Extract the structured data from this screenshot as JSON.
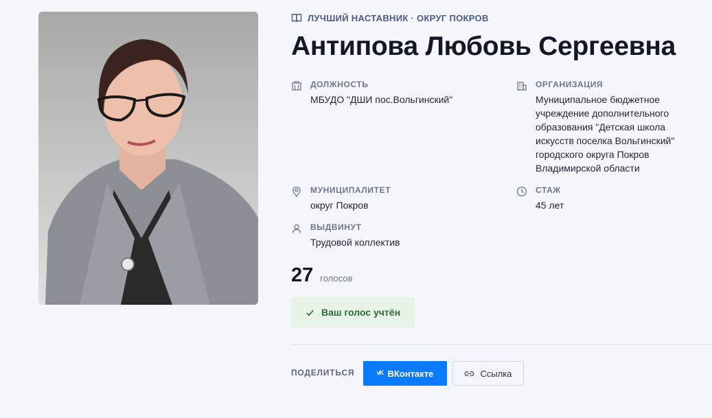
{
  "category": {
    "icon": "book-icon",
    "text": "ЛУЧШИЙ НАСТАВНИК · ОКРУГ ПОКРОВ"
  },
  "person": {
    "name": "Антипова Любовь Сергеевна",
    "photo_alt": "portrait"
  },
  "fields": {
    "position": {
      "icon": "building-icon",
      "label": "ДОЛЖНОСТЬ",
      "value": "МБУДО \"ДШИ пос.Вольгинский\""
    },
    "organization": {
      "icon": "office-icon",
      "label": "ОРГАНИЗАЦИЯ",
      "value": "Муниципальное бюджетное\nучреждение дополнительного\nобразования \"Детская школа\nискусств поселка Вольгинский\"\nгородского округа Покров\nВладимирской области"
    },
    "municipality": {
      "icon": "location-pin-icon",
      "label": "МУНИЦИПАЛИТЕТ",
      "value": "округ Покров"
    },
    "experience": {
      "icon": "clock-icon",
      "label": "СТАЖ",
      "value": "45 лет"
    },
    "nominated": {
      "icon": "user-icon",
      "label": "ВЫДВИНУТ",
      "value": "Трудовой коллектив"
    }
  },
  "votes": {
    "count": "27",
    "label": "голосов"
  },
  "vote_status": {
    "icon": "check-icon",
    "text": "Ваш голос учтён"
  },
  "share": {
    "label": "ПОДЕЛИТЬСЯ",
    "vk_label": "ВКонтакте",
    "link_label": "Ссылка"
  },
  "colors": {
    "accent": "#0a7aff",
    "success_bg": "#e6f3e6",
    "success_text": "#2e6b35",
    "page_bg": "#f4f6fb"
  }
}
